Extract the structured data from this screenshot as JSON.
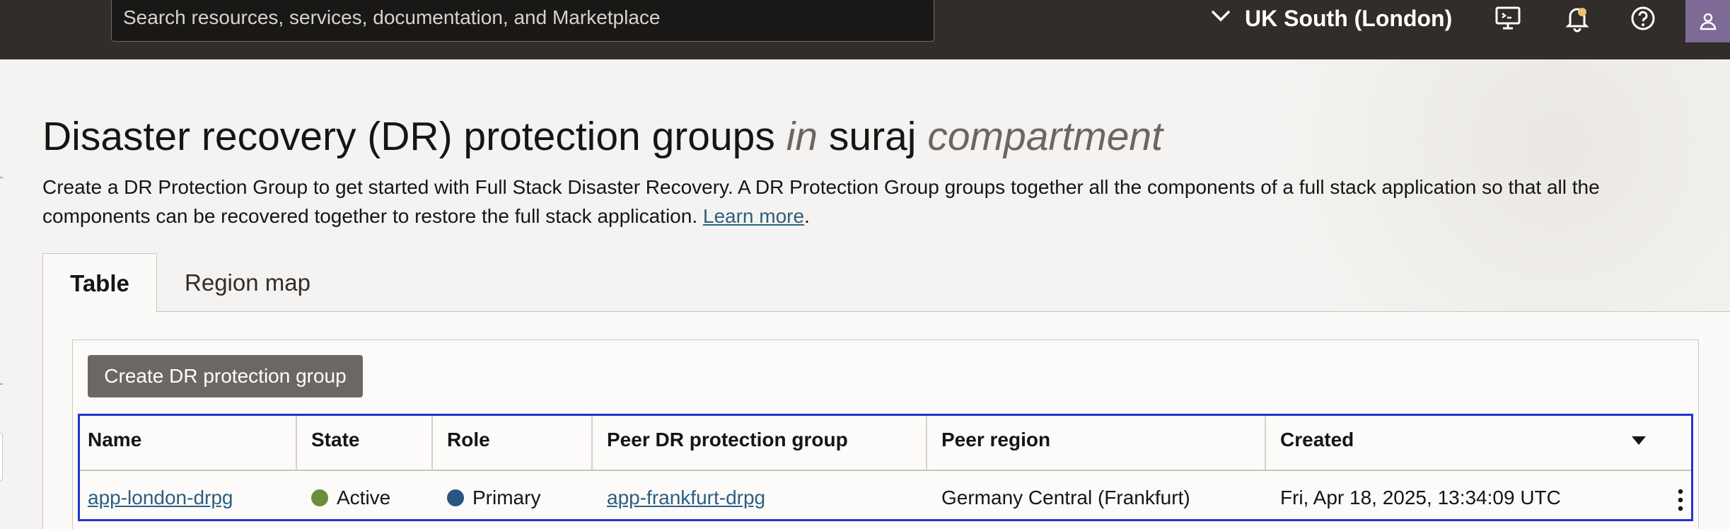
{
  "header": {
    "search_placeholder": "Search resources, services, documentation, and Marketplace",
    "region_label": "UK South (London)"
  },
  "page": {
    "title_main": "Disaster recovery (DR) protection groups",
    "title_in": "in",
    "title_compartment_name": "suraj",
    "title_compartment_word": "compartment",
    "description": "Create a DR Protection Group to get started with Full Stack Disaster Recovery. A DR Protection Group groups together all the components of a full stack application so that all the components can be recovered together to restore the full stack application.",
    "learn_more": "Learn more",
    "period": "."
  },
  "tabs": [
    {
      "label": "Table",
      "active": true
    },
    {
      "label": "Region map",
      "active": false
    }
  ],
  "toolbar": {
    "create_label": "Create DR protection group"
  },
  "table": {
    "columns": [
      "Name",
      "State",
      "Role",
      "Peer DR protection group",
      "Peer region",
      "Created"
    ],
    "rows": [
      {
        "name": "app-london-drpg",
        "state": "Active",
        "role": "Primary",
        "peer_group": "app-frankfurt-drpg",
        "peer_region": "Germany Central (Frankfurt)",
        "created": "Fri, Apr 18, 2025, 13:34:09 UTC"
      }
    ]
  },
  "colors": {
    "state_active": "#6a8f3a",
    "role_primary": "#2a5580",
    "highlight_border": "#1f35d1",
    "link": "#2d5f80"
  }
}
